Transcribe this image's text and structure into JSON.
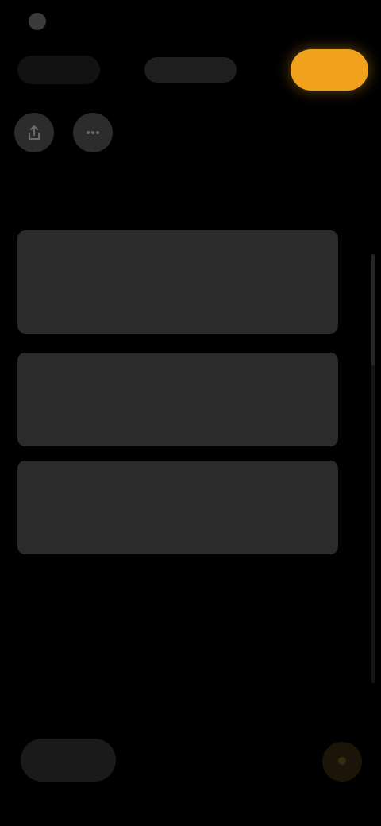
{
  "colors": {
    "background": "#000000",
    "accent": "#f1a21d",
    "card": "#2b2b2b",
    "button": "#2c2c2c"
  },
  "status_bar": {
    "time": "",
    "right_text": ""
  },
  "top_bar": {
    "cancel_label": "",
    "title": "",
    "done_label": ""
  },
  "format_row": {
    "buttons": [
      {
        "icon": "share-icon"
      },
      {
        "icon": "more-icon"
      }
    ]
  },
  "cards": [
    {
      "title": "",
      "body": ""
    },
    {
      "title": "",
      "body": ""
    },
    {
      "title": "",
      "body": ""
    }
  ],
  "bottom_bar": {
    "pill_label": "",
    "circle_icon": "compose-icon"
  }
}
